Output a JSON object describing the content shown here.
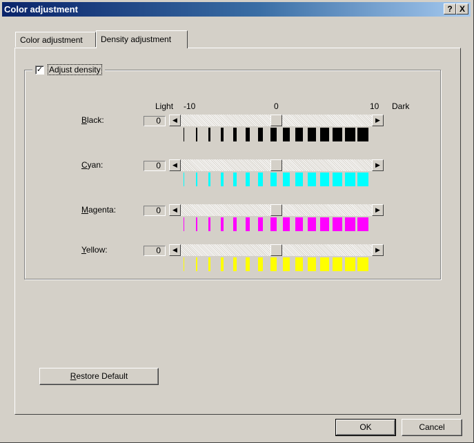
{
  "window": {
    "title": "Color adjustment",
    "help_label": "?",
    "close_label": "X"
  },
  "tabs": [
    {
      "label": "Color adjustment",
      "selected": false
    },
    {
      "label": "Density adjustment",
      "selected": true
    }
  ],
  "group": {
    "checkbox_label": "Adjust density",
    "checked": true,
    "check_mark": "✓"
  },
  "scale": {
    "light_label": "Light",
    "min_label": "-10",
    "mid_label": "0",
    "max_label": "10",
    "dark_label": "Dark",
    "min": -10,
    "max": 10
  },
  "rows": [
    {
      "key": "B",
      "rest": "lack:",
      "value": "0",
      "level": 0,
      "color": "#000000"
    },
    {
      "key": "C",
      "rest": "yan:",
      "value": "0",
      "level": 0,
      "color": "#00ffff"
    },
    {
      "key": "M",
      "rest": "agenta:",
      "value": "0",
      "level": 0,
      "color": "#ff00ff"
    },
    {
      "key": "Y",
      "rest": "ellow:",
      "value": "0",
      "level": 0,
      "color": "#ffff00"
    }
  ],
  "scroll_arrows": {
    "left": "◀",
    "right": "▶"
  },
  "buttons": {
    "restore_key": "R",
    "restore_rest": "estore Default",
    "ok": "OK",
    "cancel": "Cancel"
  }
}
